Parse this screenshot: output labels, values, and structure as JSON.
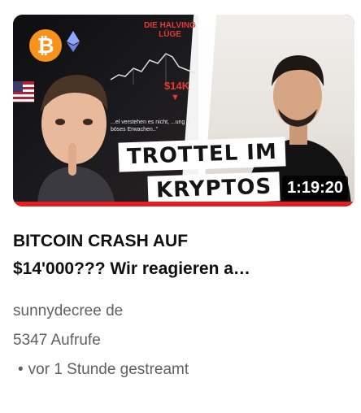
{
  "thumbnail": {
    "halving_text": "DIE HALVING LÜGE",
    "price_badge": "$14K",
    "caption": "...el verstehen es nicht, ...ung & böses Erwachen..\"",
    "banner_line1": "TROTTEL IM",
    "banner_line2": "KRYPTOS",
    "duration": "1:19:20",
    "colors": {
      "accent_red": "#e02121",
      "bitcoin_orange": "#f7931a"
    }
  },
  "video": {
    "title_line1": "BITCOIN CRASH AUF",
    "title_line2": "$14'000??? Wir reagieren a…",
    "channel": "sunnydecree de",
    "views": "5347 Aufrufe",
    "status_bullet": "•",
    "status": "vor 1 Stunde gestreamt"
  }
}
